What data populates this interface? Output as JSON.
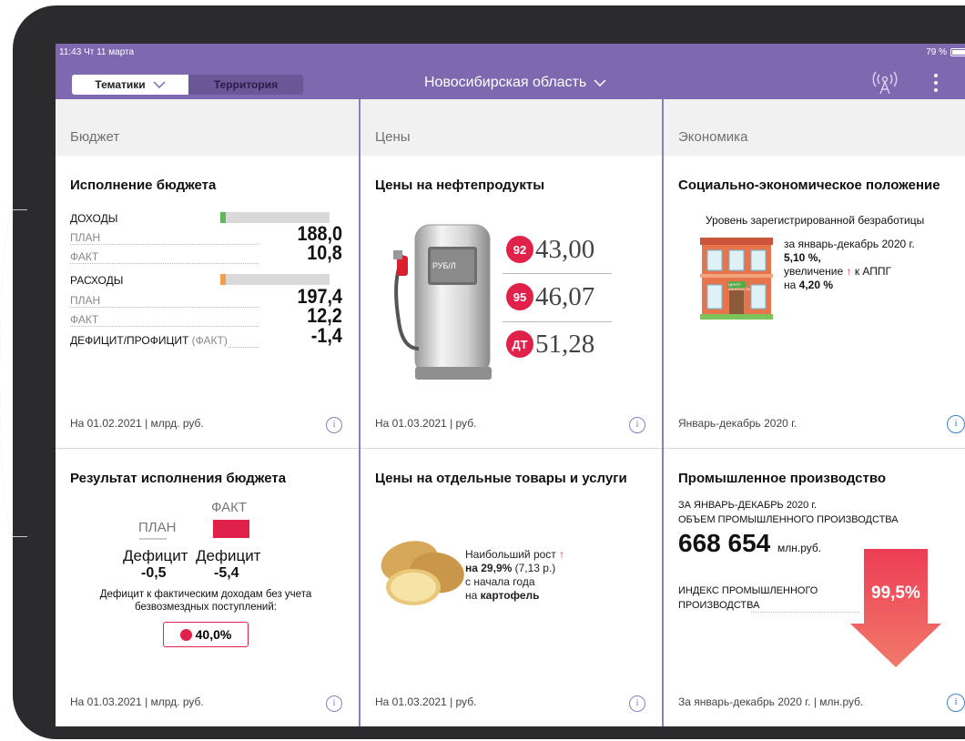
{
  "status": {
    "time": "11:43",
    "date": "Чт 11 марта",
    "battery": "79 %"
  },
  "topbar": {
    "tab_active": "Тематики",
    "tab_inactive": "Территория",
    "region": "Новосибирская область"
  },
  "colors": {
    "accent": "#7e68b0",
    "red": "#e0224a",
    "green": "#5cb85c",
    "orange": "#f0a04b"
  },
  "columns": [
    {
      "heading": "Бюджет",
      "cards": [
        {
          "title": "Исполнение бюджета",
          "income_label": "ДОХОДЫ",
          "income_fill": 0.05,
          "plan_label": "ПЛАН",
          "income_plan": "188,0",
          "fact_label": "ФАКТ",
          "income_fact": "10,8",
          "expense_label": "РАСХОДЫ",
          "expense_fill": 0.05,
          "expense_plan": "197,4",
          "expense_fact": "12,2",
          "deficit_label": "ДЕФИЦИТ/ПРОФИЦИТ",
          "deficit_suffix": "(ФАКТ)",
          "deficit_value": "-1,4",
          "footer": "На 01.02.2021 | млрд. руб."
        },
        {
          "title": "Результат исполнения бюджета",
          "fact_label": "ФАКТ",
          "plan_label": "ПЛАН",
          "deficit_word": "Дефицит",
          "plan_value": "-0,5",
          "fact_value": "-5,4",
          "note": "Дефицит к фактическим доходам без учета безвозмездных поступлений:",
          "percent": "40,0%",
          "footer": "На 01.03.2021 | млрд. руб."
        }
      ]
    },
    {
      "heading": "Цены",
      "cards": [
        {
          "title": "Цены на нефтепродукты",
          "pump_label": "РУБ/Л",
          "fuels": [
            {
              "grade": "92",
              "price": "43,00"
            },
            {
              "grade": "95",
              "price": "46,07"
            },
            {
              "grade": "ДТ",
              "price": "51,28"
            }
          ],
          "footer": "На 01.03.2021 | руб."
        },
        {
          "title": "Цены на отдельные товары и услуги",
          "line1": "Наибольший рост",
          "line2_bold": "на 29,9%",
          "line2_rest": " (7,13 р.)",
          "line3": "с начала года",
          "line4_prefix": "на ",
          "line4_bold": "картофель",
          "footer": "На 01.03.2021 | руб."
        }
      ]
    },
    {
      "heading": "Экономика",
      "cards": [
        {
          "title": "Социально-экономическое положение",
          "subtitle": "Уровень зарегистрированной безработицы",
          "period": "за январь-декабрь 2020 г.",
          "rate": "5,10 %,",
          "change_prefix": "увеличение",
          "change_suffix": "к АППГ",
          "change_prefix2": "на ",
          "change_value": "4,20 %",
          "building_sign": "ЦЕНТР ЗАНЯТОСТИ",
          "footer": "Январь-декабрь 2020 г."
        },
        {
          "title": "Промышленное производство",
          "line1": "ЗА ЯНВАРЬ-ДЕКАБРЬ 2020 г.",
          "line2": "ОБЪЕМ ПРОМЫШЛЕННОГО ПРОИЗВОДСТВА",
          "volume": "668 654",
          "volume_unit": "млн.руб.",
          "index_label_1": "ИНДЕКС ПРОМЫШЛЕННОГО",
          "index_label_2": "ПРОИЗВОДСТВА",
          "index_value": "99,5%",
          "footer": "За январь-декабрь 2020 г. | млн.руб."
        }
      ]
    }
  ]
}
